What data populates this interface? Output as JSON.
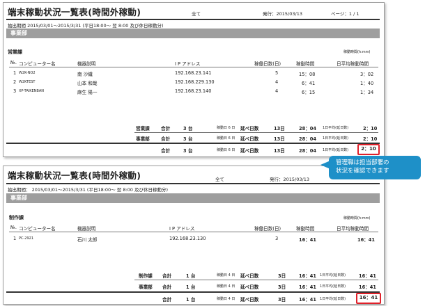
{
  "report1": {
    "title": "端末稼動状況一覧表(時間外稼動)",
    "scope": "全て",
    "issued": "発行：2015/03/13",
    "page": "ページ：1 / 1",
    "period": "抽出期間  2015/03/01～2015/3/31  (平日18:00～ 翌 8:00 及び休日稼動分)",
    "department": "事業部",
    "section": "営業課",
    "unit_label": "稼動時間(h:mm)",
    "columns": [
      "№.",
      "コンピューター名",
      "機器説明",
      "I P アドレス",
      "稼働日数(日)",
      "稼動時間",
      "日平均稼動時間"
    ],
    "rows": [
      {
        "no": "1",
        "name": "W2K-NO2",
        "desc": "南 沙織",
        "ip": "192.168.23.141",
        "days": "5",
        "time": "15：08",
        "avg": "3：02"
      },
      {
        "no": "2",
        "name": "W2KTEST",
        "desc": "山本 和哉",
        "ip": "192.168.229.130",
        "days": "4",
        "time": "6：41",
        "avg": "1：40"
      },
      {
        "no": "3",
        "name": "XP-TAIKENBAN",
        "desc": "麻生 陽一",
        "ip": "192.168.23.140",
        "days": "4",
        "time": "6：15",
        "avg": "1：34"
      }
    ],
    "subtotals": [
      {
        "label": "営業課",
        "total": "合計",
        "count": "3 台",
        "dayslabel": "稼動日 6 日",
        "nobe": "延べ日数",
        "nobedays": "13日",
        "time": "28：04",
        "avglabel": "1日平均(延日数)",
        "avg": "2：10"
      },
      {
        "label": "事業部",
        "total": "合計",
        "count": "3 台",
        "dayslabel": "稼動日 6 日",
        "nobe": "延べ日数",
        "nobedays": "13日",
        "time": "28：04",
        "avglabel": "1日平均(延日数)",
        "avg": "2：10"
      }
    ],
    "grand": {
      "total": "合計",
      "count": "3 台",
      "dayslabel": "稼動日 6 日",
      "nobe": "延べ日数",
      "nobedays": "13日",
      "time": "28：04",
      "avglabel": "1日平均(延日数)",
      "avg": "2：10"
    }
  },
  "report2": {
    "title": "端末稼動状況一覧表(時間外稼動)",
    "scope": "全て",
    "issued": "発行：2015/03/13",
    "period": "抽出期間：  2015/03/01～2015/3/31  (平日18:00～ 翌 8:00 及び休日稼動分)",
    "department": "事業部",
    "section": "制作課",
    "unit_label": "稼動時間(h:mm)",
    "columns": [
      "№.",
      "コンピューター名",
      "機器説明",
      "I P アドレス",
      "稼働日数(日)",
      "稼動時間",
      "日平均稼動時間"
    ],
    "rows": [
      {
        "no": "1",
        "name": "PC-2921",
        "desc": "石川 太郎",
        "ip": "192.168.23.130",
        "days": "3",
        "time": "16：41",
        "avg": "16：41"
      }
    ],
    "subtotals": [
      {
        "label": "制作課",
        "total": "合計",
        "count": "1 台",
        "dayslabel": "稼動日 4 日",
        "nobe": "延べ日数",
        "nobedays": "3日",
        "time": "16：41",
        "avglabel": "1日平均(延日数)",
        "avg": "16：41"
      },
      {
        "label": "事業部",
        "total": "合計",
        "count": "1 台",
        "dayslabel": "稼動日 4 日",
        "nobe": "延べ日数",
        "nobedays": "3日",
        "time": "16：41",
        "avglabel": "1日平均(延日数)",
        "avg": "16：41"
      }
    ],
    "grand": {
      "total": "合計",
      "count": "1 台",
      "dayslabel": "稼動日 4 日",
      "nobe": "延べ日数",
      "nobedays": "3日",
      "time": "16：41",
      "avglabel": "1日平均(延日数)",
      "avg": "16：41"
    }
  },
  "callout": {
    "line1": "管理職は担当部署の",
    "line2": "状況を確認できます"
  },
  "colors": {
    "callout": "#1e90c8",
    "highlight": "#e0202a",
    "band": "#9e9e9e"
  }
}
